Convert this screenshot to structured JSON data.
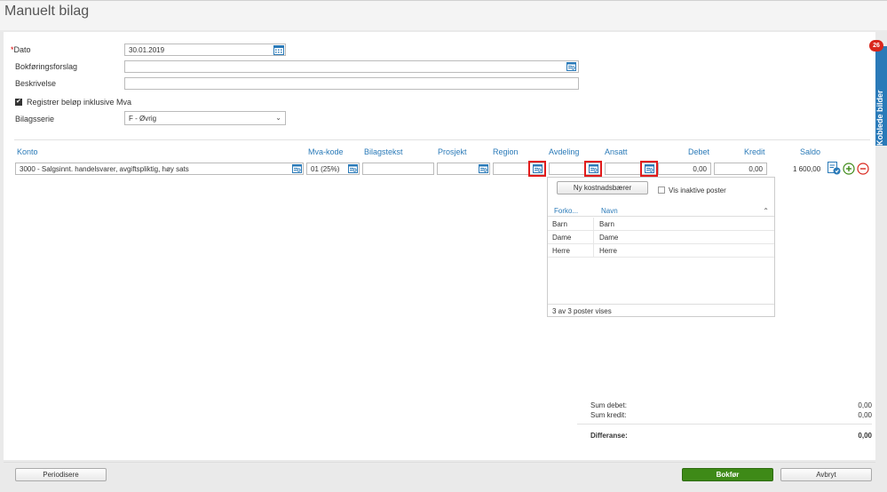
{
  "page": {
    "title": "Manuelt bilag"
  },
  "form": {
    "dato_label": "Dato",
    "dato_value": "30.01.2019",
    "bokforingsforslag_label": "Bokføringsforslag",
    "beskrivelse_label": "Beskrivelse",
    "inkl_mva_label": "Registrer beløp inklusive Mva",
    "inkl_mva_checked": true,
    "bilagsserie_label": "Bilagsserie",
    "bilagsserie_value": "F - Øvrig"
  },
  "columns": {
    "konto": "Konto",
    "mva_kode": "Mva-kode",
    "bilagstekst": "Bilagstekst",
    "prosjekt": "Prosjekt",
    "region": "Region",
    "avdeling": "Avdeling",
    "ansatt": "Ansatt",
    "debet": "Debet",
    "kredit": "Kredit",
    "saldo": "Saldo"
  },
  "row": {
    "konto": "3000 - Salgsinnt. handelsvarer, avgiftspliktig, høy sats",
    "mva_kode": "01 (25%)",
    "debet": "0,00",
    "kredit": "0,00",
    "saldo": "1 600,00"
  },
  "dropdown": {
    "new_button": "Ny kostnadsbærer",
    "show_inactive_label": "Vis inaktive poster",
    "headers": {
      "code": "Forko...",
      "name": "Navn"
    },
    "items": [
      {
        "code": "Barn",
        "name": "Barn"
      },
      {
        "code": "Dame",
        "name": "Dame"
      },
      {
        "code": "Herre",
        "name": "Herre"
      }
    ],
    "footer": "3 av 3 poster vises"
  },
  "summary": {
    "sum_debet_label": "Sum debet:",
    "sum_debet_value": "0,00",
    "sum_kredit_label": "Sum kredit:",
    "sum_kredit_value": "0,00",
    "differanse_label": "Differanse:",
    "differanse_value": "0,00"
  },
  "footer": {
    "periodisere": "Periodisere",
    "bokfor": "Bokfør",
    "avbryt": "Avbryt"
  },
  "side_tab": {
    "label": "Koblede bilder",
    "badge": "26"
  },
  "colors": {
    "accent": "#2a7ab8",
    "primary_button": "#3e8a17",
    "highlight": "#e21b1b",
    "badge": "#d9261c"
  }
}
